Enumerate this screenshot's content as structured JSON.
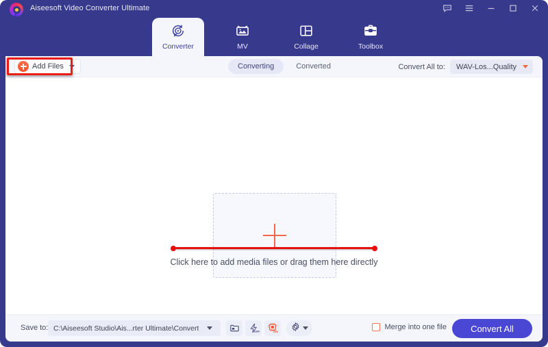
{
  "window": {
    "title": "Aiseesoft Video Converter Ultimate",
    "logo_icon": "aiseesoft-logo-icon",
    "accent_color": "#4a47d5",
    "header_color": "#373a8c",
    "controls": [
      {
        "name": "feedback-icon",
        "label": "Feedback"
      },
      {
        "name": "menu-icon",
        "label": "Menu"
      },
      {
        "name": "minimize-icon",
        "label": "Minimize"
      },
      {
        "name": "maximize-icon",
        "label": "Maximize"
      },
      {
        "name": "close-icon",
        "label": "Close"
      }
    ]
  },
  "nav": {
    "tabs": [
      {
        "id": "converter",
        "label": "Converter",
        "icon": "converter-icon",
        "active": true
      },
      {
        "id": "mv",
        "label": "MV",
        "icon": "mv-icon",
        "active": false
      },
      {
        "id": "collage",
        "label": "Collage",
        "icon": "collage-icon",
        "active": false
      },
      {
        "id": "toolbox",
        "label": "Toolbox",
        "icon": "toolbox-icon",
        "active": false
      }
    ]
  },
  "toolbar": {
    "add_files_label": "Add Files",
    "add_files_icon": "plus-circle-icon",
    "add_files_caret_icon": "chevron-down-icon",
    "segments": [
      {
        "id": "converting",
        "label": "Converting",
        "active": true
      },
      {
        "id": "converted",
        "label": "Converted",
        "active": false
      }
    ],
    "convert_all_to_label": "Convert All to:",
    "format_value": "WAV-Los...Quality",
    "format_caret_icon": "chevron-down-icon"
  },
  "content": {
    "dropzone_icon": "plus-icon",
    "hint_text": "Click here to add media files or drag them here directly"
  },
  "annotations": {
    "color": "#ee1c16",
    "box_target": "add-files-button",
    "underline_target": "drop-hint-text"
  },
  "bottom": {
    "save_to_label": "Save to:",
    "save_to_path": "C:\\Aiseesoft Studio\\Ais...rter Ultimate\\Converted",
    "save_to_caret_icon": "chevron-down-icon",
    "buttons": [
      {
        "id": "open-folder",
        "icon": "folder-icon"
      },
      {
        "id": "hardware-accel",
        "icon": "lightning-off-icon",
        "state": "OFF"
      },
      {
        "id": "gpu-accel",
        "icon": "chip-on-icon",
        "state": "ON"
      },
      {
        "id": "preferences",
        "icon": "gear-icon"
      }
    ],
    "merge_label": "Merge into one file",
    "merge_checked": false,
    "convert_all_label": "Convert All"
  }
}
